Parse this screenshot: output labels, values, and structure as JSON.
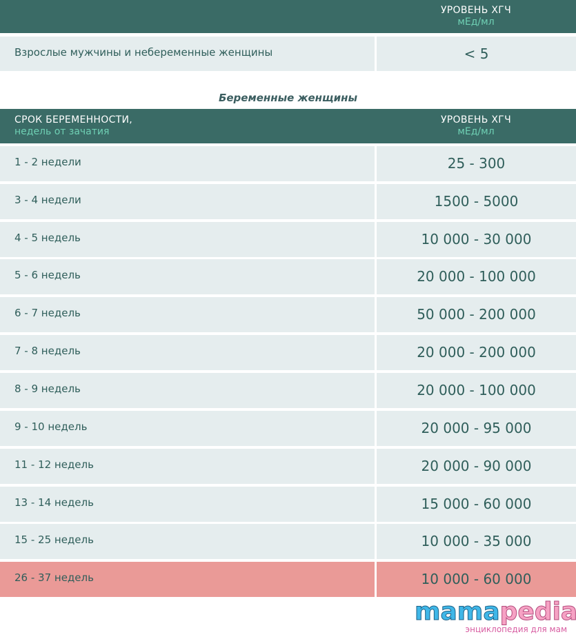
{
  "top_header": {
    "col2_title": "УРОВЕНЬ ХГЧ",
    "col2_unit": "мЕд/мл"
  },
  "non_pregnant_row": {
    "group": "Взрослые мужчины и небеременные женщины",
    "value": "< 5"
  },
  "section_caption": "Беременные женщины",
  "pregnant_header": {
    "col1_title": "СРОК БЕРЕМЕННОСТИ,",
    "col1_sub": "недель от зачатия",
    "col2_title": "УРОВЕНЬ ХГЧ",
    "col2_unit": "мЕд/мл"
  },
  "pregnant_rows": [
    {
      "term": "1 - 2 недели",
      "value": "25 - 300"
    },
    {
      "term": "3 - 4 недели",
      "value": "1500 - 5000"
    },
    {
      "term": "4 - 5 недель",
      "value": "10 000 - 30 000"
    },
    {
      "term": "5 - 6 недель",
      "value": "20 000 - 100 000"
    },
    {
      "term": "6 - 7 недель",
      "value": "50 000 - 200 000"
    },
    {
      "term": "7 - 8 недель",
      "value": "20 000 - 200 000"
    },
    {
      "term": "8 - 9 недель",
      "value": "20 000 - 100 000"
    },
    {
      "term": "9 - 10 недель",
      "value": "20 000 - 95 000"
    },
    {
      "term": "11 - 12 недель",
      "value": "20 000 - 90 000"
    },
    {
      "term": "13 - 14 недель",
      "value": "15 000 - 60 000"
    },
    {
      "term": "15 - 25 недель",
      "value": "10 000 - 35 000"
    },
    {
      "term": "26 - 37 недель",
      "value": "10 000 - 60 000"
    }
  ],
  "logo": {
    "word_part1": "mama",
    "word_part2": "pedia",
    "tagline": "энциклопедия для мам"
  },
  "colors": {
    "header_bg": "#3a6b66",
    "unit_text": "#6fd0b4",
    "row_bg": "#e5edee",
    "highlight_row_bg": "#ea9a97",
    "text": "#2f5e5a"
  }
}
